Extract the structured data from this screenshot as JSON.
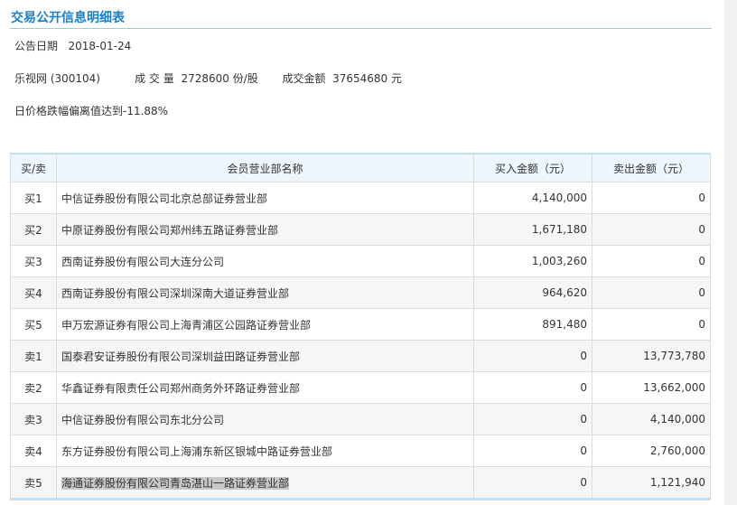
{
  "title": "交易公开信息明细表",
  "date_label": "公告日期",
  "date": "2018-01-24",
  "stock": "乐视网 (300104)",
  "volume_label": "成 交 量",
  "volume": "2728600 份/股",
  "amount_label": "成交金额",
  "amount": "37654680 元",
  "note": "日价格跌幅偏离值达到-11.88%",
  "table": {
    "headers": [
      "买/卖",
      "会员营业部名称",
      "买入金额（元）",
      "卖出金额（元）"
    ],
    "rows": [
      [
        "买1",
        "中信证券股份有限公司北京总部证券营业部",
        "4,140,000",
        "0"
      ],
      [
        "买2",
        "中原证券股份有限公司郑州纬五路证券营业部",
        "1,671,180",
        "0"
      ],
      [
        "买3",
        "西南证券股份有限公司大连分公司",
        "1,003,260",
        "0"
      ],
      [
        "买4",
        "西南证券股份有限公司深圳深南大道证券营业部",
        "964,620",
        "0"
      ],
      [
        "买5",
        "申万宏源证券有限公司上海青浦区公园路证券营业部",
        "891,480",
        "0"
      ],
      [
        "卖1",
        "国泰君安证券股份有限公司深圳益田路证券营业部",
        "0",
        "13,773,780"
      ],
      [
        "卖2",
        "华鑫证券有限责任公司郑州商务外环路证券营业部",
        "0",
        "13,662,000"
      ],
      [
        "卖3",
        "中信证券股份有限公司东北分公司",
        "0",
        "4,140,000"
      ],
      [
        "卖4",
        "东方证券股份有限公司上海浦东新区银城中路证券营业部",
        "0",
        "2,760,000"
      ],
      [
        "卖5",
        "海通证券股份有限公司青岛湛山一路证券营业部",
        "0",
        "1,121,940"
      ]
    ]
  }
}
